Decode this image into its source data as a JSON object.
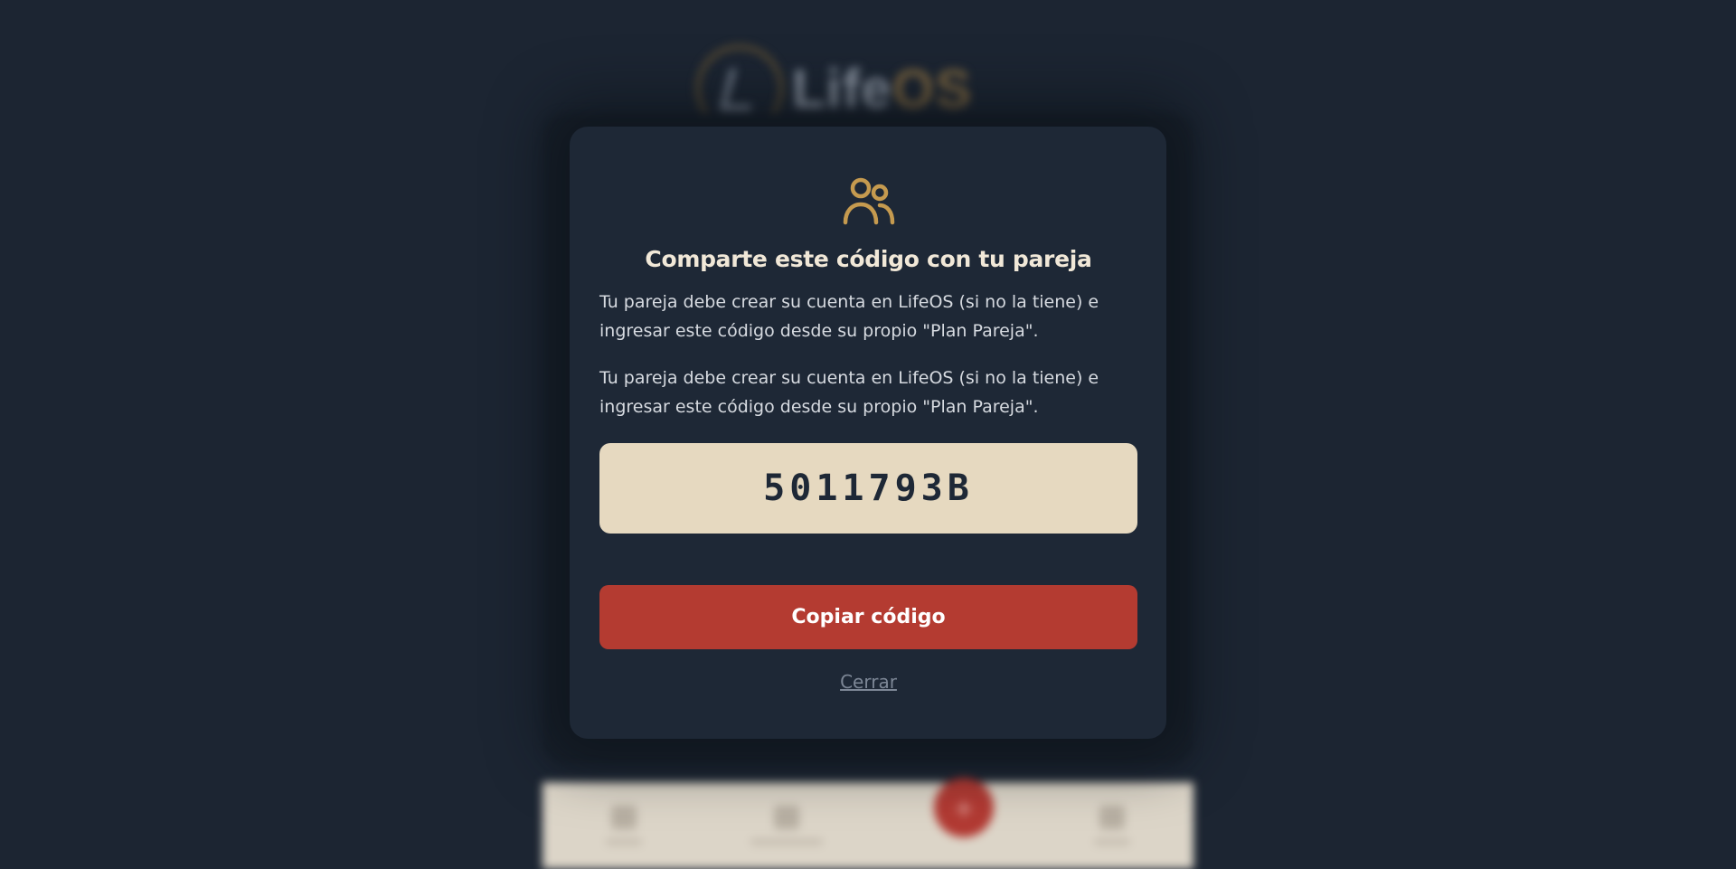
{
  "background": {
    "logo": {
      "text_primary": "Life",
      "text_accent": "OS"
    },
    "nav_items": [
      {
        "icon": "home-icon"
      },
      {
        "icon": "grid-icon"
      },
      {
        "icon": "more-icon"
      }
    ],
    "fab_label": "+"
  },
  "modal": {
    "icon": "users-icon",
    "title": "Comparte este código con tu pareja",
    "description_1": "Tu pareja debe crear su cuenta en LifeOS (si no la tiene) e ingresar este código desde su propio \"Plan Pareja\".",
    "description_2": "Tu pareja debe crear su cuenta en LifeOS (si no la tiene) e ingresar este código desde su propio \"Plan Pareja\".",
    "code": "5011793B",
    "copy_button": "Copiar código",
    "close_link": "Cerrar"
  },
  "colors": {
    "background": "#1c2532",
    "modal": "#1e2836",
    "accent_gold": "#c59a4f",
    "code_box": "#e6d9c0",
    "primary_button": "#b43b31"
  }
}
